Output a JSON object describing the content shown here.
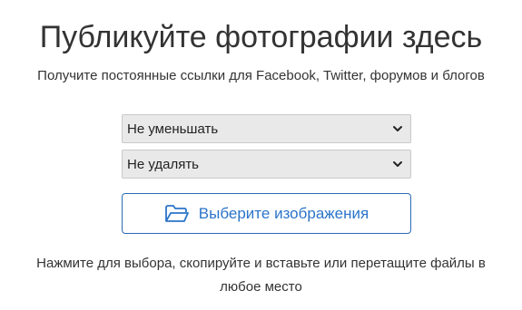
{
  "header": {
    "title": "Публикуйте фотографии здесь",
    "subtitle": "Получите постоянные ссылки для Facebook, Twitter, форумов и блогов"
  },
  "options": {
    "resize": {
      "selected": "Не уменьшать",
      "icon": "chevron-down-icon"
    },
    "expire": {
      "selected": "Не удалять",
      "icon": "chevron-down-icon"
    }
  },
  "upload": {
    "button_label": "Выберите изображения",
    "icon": "folder-open-icon",
    "accent_color": "#2b74c9"
  },
  "hint": {
    "text": "Нажмите для выбора, скопируйте и вставьте или перетащите файлы в любое место"
  }
}
